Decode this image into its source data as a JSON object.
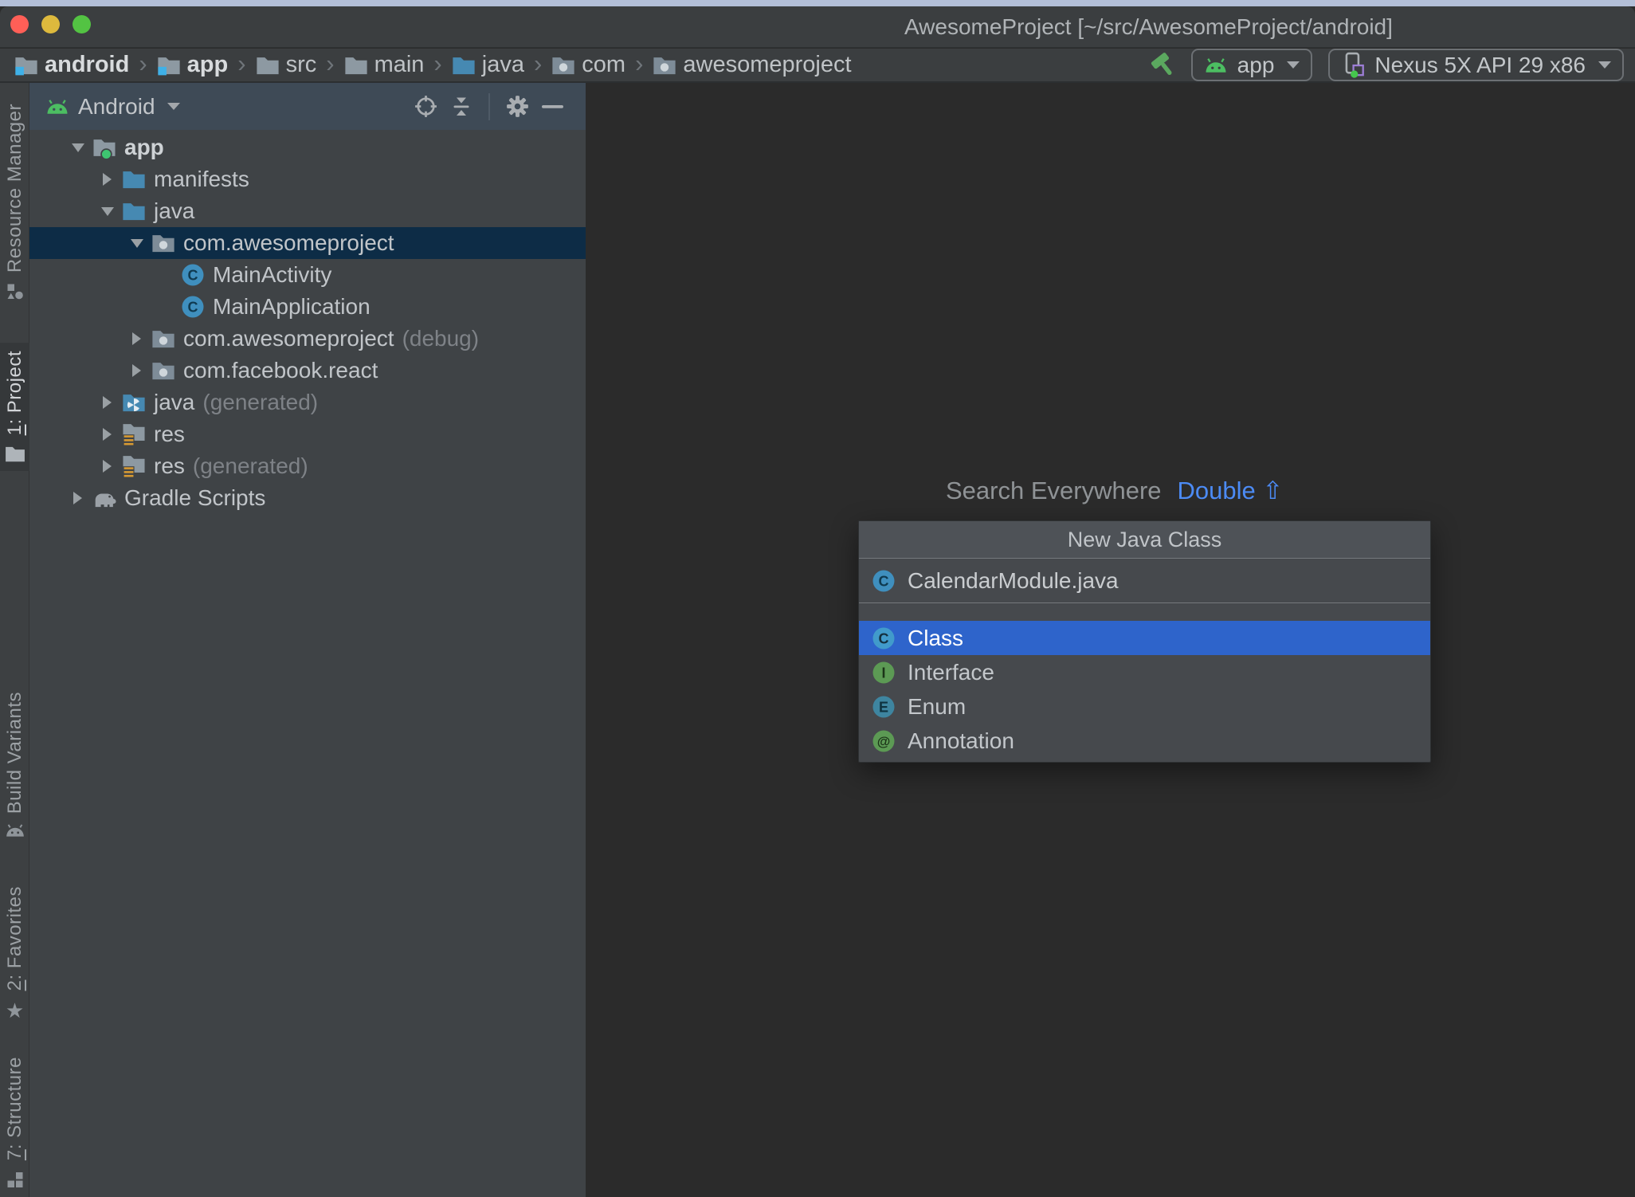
{
  "window": {
    "title": "AwesomeProject [~/src/AwesomeProject/android]"
  },
  "breadcrumbs": {
    "separator": "›",
    "items": [
      {
        "label": "android",
        "icon": "module-folder",
        "bold": true
      },
      {
        "label": "app",
        "icon": "module-folder",
        "bold": true
      },
      {
        "label": "src",
        "icon": "folder",
        "bold": false
      },
      {
        "label": "main",
        "icon": "folder",
        "bold": false
      },
      {
        "label": "java",
        "icon": "source-folder",
        "bold": false
      },
      {
        "label": "com",
        "icon": "package-folder",
        "bold": false
      },
      {
        "label": "awesomeproject",
        "icon": "package-folder",
        "bold": false
      }
    ]
  },
  "toolbar": {
    "run_config": {
      "label": "app",
      "icon": "android"
    },
    "device": {
      "label": "Nexus 5X API 29 x86",
      "icon": "phone"
    }
  },
  "stripe": {
    "tabs": [
      {
        "label": "Resource Manager",
        "mnemonic": "",
        "rest": "Resource Manager",
        "icon": "shapes",
        "active": false
      },
      {
        "label": "1: Project",
        "mnemonic": "1",
        "rest": ": Project",
        "icon": "folder",
        "active": true
      },
      {
        "label": "Build Variants",
        "mnemonic": "",
        "rest": "Build Variants",
        "icon": "android",
        "active": false
      },
      {
        "label": "2: Favorites",
        "mnemonic": "2",
        "rest": ": Favorites",
        "icon": "star",
        "active": false
      },
      {
        "label": "7: Structure",
        "mnemonic": "7",
        "rest": ": Structure",
        "icon": "structure",
        "active": false
      }
    ]
  },
  "project_panel": {
    "view": "Android",
    "tree": [
      {
        "label": "app",
        "suffix": "",
        "icon": "module-folder-dot",
        "level": 0,
        "state": "expanded",
        "selected": false,
        "bold": true
      },
      {
        "label": "manifests",
        "suffix": "",
        "icon": "source-folder",
        "level": 1,
        "state": "collapsed",
        "selected": false,
        "bold": false
      },
      {
        "label": "java",
        "suffix": "",
        "icon": "source-folder",
        "level": 1,
        "state": "expanded",
        "selected": false,
        "bold": false
      },
      {
        "label": "com.awesomeproject",
        "suffix": "",
        "icon": "package-folder",
        "level": 2,
        "state": "expanded",
        "selected": true,
        "bold": false
      },
      {
        "label": "MainActivity",
        "suffix": "",
        "icon": "class",
        "level": 3,
        "state": "leaf",
        "selected": false,
        "bold": false
      },
      {
        "label": "MainApplication",
        "suffix": "",
        "icon": "class",
        "level": 3,
        "state": "leaf",
        "selected": false,
        "bold": false
      },
      {
        "label": "com.awesomeproject",
        "suffix": "(debug)",
        "icon": "package-folder",
        "level": 2,
        "state": "collapsed",
        "selected": false,
        "bold": false
      },
      {
        "label": "com.facebook.react",
        "suffix": "",
        "icon": "package-folder",
        "level": 2,
        "state": "collapsed",
        "selected": false,
        "bold": false
      },
      {
        "label": "java",
        "suffix": "(generated)",
        "icon": "generated-source-folder",
        "level": 1,
        "state": "collapsed",
        "selected": false,
        "bold": false
      },
      {
        "label": "res",
        "suffix": "",
        "icon": "res-folder",
        "level": 1,
        "state": "collapsed",
        "selected": false,
        "bold": false
      },
      {
        "label": "res",
        "suffix": "(generated)",
        "icon": "res-folder",
        "level": 1,
        "state": "collapsed",
        "selected": false,
        "bold": false
      },
      {
        "label": "Gradle Scripts",
        "suffix": "",
        "icon": "gradle-elephant",
        "level": 0,
        "state": "collapsed",
        "selected": false,
        "bold": false
      }
    ]
  },
  "editor_hint": {
    "text": "Search Everywhere",
    "shortcut": "Double",
    "shortcut_symbol": "⇧"
  },
  "popup": {
    "title": "New Java Class",
    "input": {
      "value": "CalendarModule.java",
      "icon": "class"
    },
    "options": [
      {
        "label": "Class",
        "icon": "class",
        "selected": true
      },
      {
        "label": "Interface",
        "icon": "interface",
        "selected": false
      },
      {
        "label": "Enum",
        "icon": "enum",
        "selected": false
      },
      {
        "label": "Annotation",
        "icon": "annotation",
        "selected": false
      }
    ]
  },
  "icon_glyphs": {
    "class": "C",
    "interface": "I",
    "enum": "E",
    "annotation": "@",
    "star": "★"
  },
  "colors": {
    "selection_blue": "#2e64cb",
    "tree_selection": "#0d2c46",
    "panel_header_bg": "#3e4a56",
    "panel_bg": "#3f4346",
    "editor_bg": "#2b2b2b",
    "chrome_bg": "#3b3e40",
    "accent_green": "#4cbe62",
    "shortcut_blue": "#4c8bf5",
    "traffic_red": "#ff5f57",
    "traffic_yellow": "#ddb93d",
    "traffic_green": "#53c343"
  }
}
